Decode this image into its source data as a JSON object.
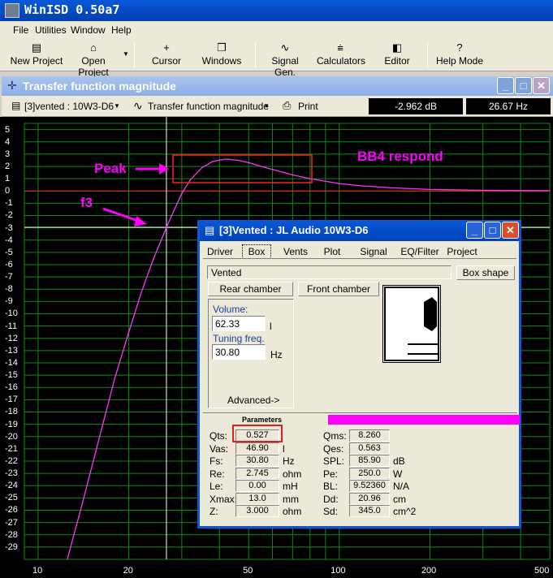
{
  "app": {
    "title": "WinISD 0.50a7"
  },
  "menu": [
    "File",
    "Utilities",
    "Window",
    "Help"
  ],
  "toolbar": {
    "new_project": "New Project",
    "open_project": "Open Project",
    "cursor": "Cursor",
    "windows": "Windows",
    "signal_gen": "Signal Gen.",
    "calculators": "Calculators",
    "editor": "Editor",
    "help_mode": "Help Mode"
  },
  "graph_window": {
    "title": "Transfer function magnitude",
    "project_select": "[3]vented : 10W3-D6",
    "graph_select": "Transfer function magnitude",
    "print": "Print",
    "readout_db": "-2.962 dB",
    "readout_hz": "26.67 Hz"
  },
  "chart_data": {
    "type": "line",
    "xscale": "log",
    "xlim": [
      9,
      500
    ],
    "ylim": [
      -30,
      5.5
    ],
    "x_ticks": [
      {
        "v": 10,
        "label": "10"
      },
      {
        "v": 20,
        "label": "20"
      },
      {
        "v": 50,
        "label": "50"
      },
      {
        "v": 100,
        "label": "100"
      },
      {
        "v": 200,
        "label": "200"
      },
      {
        "v": 500,
        "label": "500"
      }
    ],
    "y_ticks": [
      5,
      4,
      3,
      2,
      1,
      0,
      -1,
      -2,
      -3,
      -4,
      -5,
      -6,
      -7,
      -8,
      -9,
      -10,
      -11,
      -12,
      -13,
      -14,
      -15,
      -16,
      -17,
      -18,
      -19,
      -20,
      -21,
      -22,
      -23,
      -24,
      -25,
      -26,
      -27,
      -28,
      -29
    ],
    "grid": true,
    "reference_line_db": 0,
    "cursor": {
      "x": 26.67,
      "y": -2.962
    },
    "series": [
      {
        "color": "#ff33ff",
        "x": [
          12.5,
          14,
          16,
          18,
          20,
          22,
          24,
          26.67,
          28,
          30,
          32,
          35,
          38,
          42,
          46,
          50,
          55,
          60,
          70,
          80,
          100,
          120,
          150,
          200,
          300,
          500
        ],
        "y": [
          -30,
          -25.5,
          -20,
          -15.2,
          -11.5,
          -8.3,
          -5.7,
          -2.96,
          -1.8,
          -0.2,
          0.9,
          1.9,
          2.4,
          2.6,
          2.5,
          2.3,
          2.0,
          1.75,
          1.3,
          1.0,
          0.6,
          0.4,
          0.25,
          0.12,
          0.05,
          0.02
        ]
      }
    ]
  },
  "annotations": {
    "peak": "Peak",
    "f3": "f3",
    "respond": "BB4 respond"
  },
  "dialog": {
    "title": "[3]Vented : JL Audio 10W3-D6",
    "tabs": [
      "Driver",
      "Box",
      "Vents",
      "Plot",
      "Signal",
      "EQ/Filter",
      "Project"
    ],
    "box_type": "Vented",
    "box_shape": "Box shape",
    "rear_chamber": "Rear chamber",
    "front_chamber": "Front chamber",
    "volume_label": "Volume:",
    "volume_value": "62.33",
    "volume_unit": "l",
    "tuning_label": "Tuning freq.",
    "tuning_value": "30.80",
    "tuning_unit": "Hz",
    "advanced": "Advanced->",
    "params_header": "Parameters",
    "params_left": [
      {
        "name": "Qts:",
        "value": "0.527",
        "unit": ""
      },
      {
        "name": "Vas:",
        "value": "46.90",
        "unit": "l"
      },
      {
        "name": "Fs:",
        "value": "30.80",
        "unit": "Hz"
      },
      {
        "name": "Re:",
        "value": "2.745",
        "unit": "ohm"
      },
      {
        "name": "Le:",
        "value": "0.00",
        "unit": "mH"
      },
      {
        "name": "Xmax:",
        "value": "13.0",
        "unit": "mm"
      },
      {
        "name": "Z:",
        "value": "3.000",
        "unit": "ohm"
      }
    ],
    "params_right": [
      {
        "name": "Qms:",
        "value": "8.260",
        "unit": ""
      },
      {
        "name": "Qes:",
        "value": "0.563",
        "unit": ""
      },
      {
        "name": "SPL:",
        "value": "85.90",
        "unit": "dB"
      },
      {
        "name": "Pe:",
        "value": "250.0",
        "unit": "W"
      },
      {
        "name": "BL:",
        "value": "9.52360",
        "unit": "N/A"
      },
      {
        "name": "Dd:",
        "value": "20.96",
        "unit": "cm"
      },
      {
        "name": "Sd:",
        "value": "345.0",
        "unit": "cm^2"
      }
    ]
  }
}
